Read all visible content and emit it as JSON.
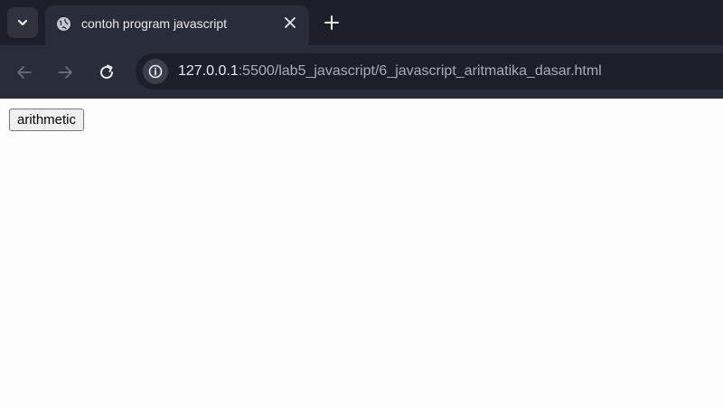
{
  "browser": {
    "tab": {
      "title": "contoh program javascript"
    },
    "address": {
      "host": "127.0.0.1",
      "rest": ":5500/lab5_javascript/6_javascript_aritmatika_dasar.html"
    }
  },
  "page": {
    "arithmetic_button_label": "arithmetic"
  },
  "icons": {
    "tab_search": "chevron-down-icon",
    "favicon": "globe-icon",
    "tab_close": "close-icon",
    "new_tab": "plus-icon",
    "back": "arrow-left-icon",
    "forward": "arrow-right-icon",
    "reload": "reload-icon",
    "site_info": "info-icon"
  },
  "colors": {
    "tabstrip_bg": "#1c1f2a",
    "toolbar_bg": "#292d3a",
    "page_bg": "#fdfdfd"
  }
}
